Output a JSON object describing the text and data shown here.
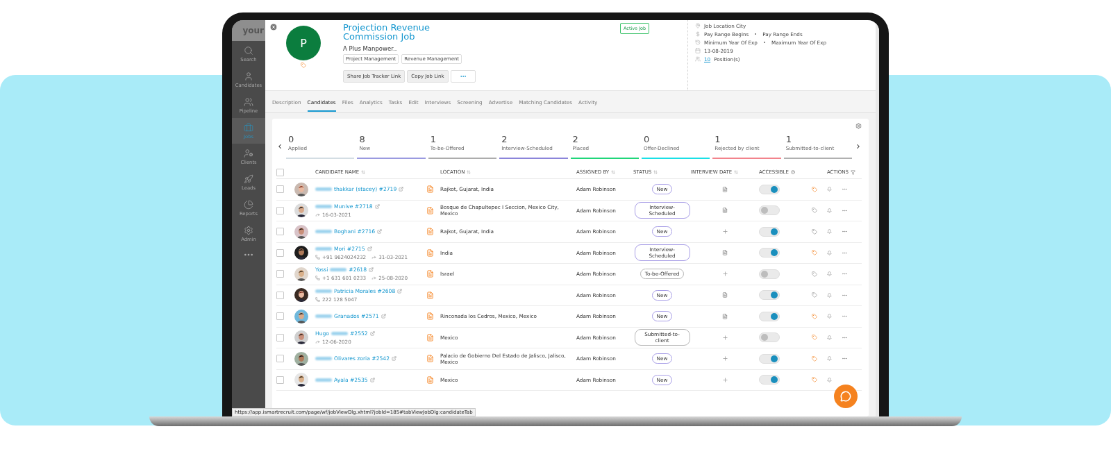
{
  "sidebar": {
    "logo": "your",
    "items": [
      {
        "label": "Search",
        "selected": false
      },
      {
        "label": "Candidates",
        "selected": false
      },
      {
        "label": "Pipeline",
        "selected": false
      },
      {
        "label": "Jobs",
        "selected": true
      },
      {
        "label": "Clients",
        "selected": false
      },
      {
        "label": "Leads",
        "selected": false
      },
      {
        "label": "Reports",
        "selected": false
      },
      {
        "label": "Admin",
        "selected": false
      }
    ]
  },
  "job": {
    "initial": "P",
    "title": "Projection Revenue Commission Job",
    "company": "A Plus Manpower..",
    "skills": [
      "Project Management",
      "Revenue Management"
    ],
    "buttons": [
      "Share Job Tracker Link",
      "Copy Job Link"
    ],
    "status": "Active Job",
    "details": {
      "location": "Job Location City",
      "pay_from": "Pay Range Begins",
      "pay_to": "Pay Range Ends",
      "exp_from": "Minimum Year Of Exp",
      "exp_to": "Maximum Year Of Exp",
      "date": "13-08-2019",
      "positions": "10",
      "positions_label": "Position(s)"
    }
  },
  "tabs": [
    {
      "label": "Description",
      "selected": false
    },
    {
      "label": "Candidates",
      "selected": true
    },
    {
      "label": "Files",
      "selected": false
    },
    {
      "label": "Analytics",
      "selected": false
    },
    {
      "label": "Tasks",
      "selected": false
    },
    {
      "label": "Edit",
      "selected": false
    },
    {
      "label": "Interviews",
      "selected": false
    },
    {
      "label": "Screening",
      "selected": false
    },
    {
      "label": "Advertise",
      "selected": false
    },
    {
      "label": "Matching Candidates",
      "selected": false
    },
    {
      "label": "Activity",
      "selected": false
    }
  ],
  "stats": [
    {
      "count": "0",
      "label": "Applied",
      "color": "#d3dde3"
    },
    {
      "count": "8",
      "label": "New",
      "color": "#9a9ae0"
    },
    {
      "count": "1",
      "label": "To-be-Offered",
      "color": "#acacac"
    },
    {
      "count": "2",
      "label": "Interview-Scheduled",
      "color": "#8b85da"
    },
    {
      "count": "2",
      "label": "Placed",
      "color": "#1fd67a"
    },
    {
      "count": "0",
      "label": "Offer-Declined",
      "color": "#1ae0e6"
    },
    {
      "count": "1",
      "label": "Rejected by client",
      "color": "#f2838c"
    },
    {
      "count": "1",
      "label": "Submitted-to-client",
      "color": "#b0b0b0"
    }
  ],
  "table": {
    "columns": [
      "CANDIDATE NAME",
      "LOCATION",
      "ASSIGNED BY",
      "STATUS",
      "INTERVIEW DATE",
      "ACCESSIBLE",
      "ACTIONS"
    ],
    "all_checked": false,
    "rows": [
      {
        "name_after": "thakkar (stacey) #2719",
        "location": "Rajkot, Gujarat, India",
        "assigned": "Adam Robinson",
        "status": {
          "label": "New",
          "color": "#a79de6"
        },
        "interview": {
          "kind": "file"
        },
        "accessible": true,
        "tagged": true,
        "checked": false,
        "menu": true
      },
      {
        "name_after": "Munive #2718",
        "date": "16-03-2021",
        "location": "Bosque de Chapultepec I Seccion, Mexico City, Mexico",
        "assigned": "Adam Robinson",
        "status": {
          "label": "Interview-Scheduled",
          "color": "#a79de6"
        },
        "interview": {
          "kind": "file"
        },
        "accessible": false,
        "tagged": false,
        "checked": false,
        "menu": true
      },
      {
        "name_after": "Boghani #2716",
        "location": "Rajkot, Gujarat, India",
        "assigned": "Adam Robinson",
        "status": {
          "label": "New",
          "color": "#a79de6"
        },
        "interview": {
          "kind": "add"
        },
        "accessible": true,
        "tagged": false,
        "checked": false,
        "menu": true
      },
      {
        "name_after": "Mori #2715",
        "phone": "+91 9624024232",
        "date": "31-03-2021",
        "location": "India",
        "assigned": "Adam Robinson",
        "status": {
          "label": "Interview-Scheduled",
          "color": "#a79de6"
        },
        "interview": {
          "kind": "file"
        },
        "accessible": true,
        "tagged": true,
        "checked": false,
        "menu": true
      },
      {
        "name_before": "Yossi",
        "name_after": "#2618",
        "phone": "+1 631 601 0233",
        "date": "25-08-2020",
        "location": "Israel",
        "assigned": "Adam Robinson",
        "status": {
          "label": "To-be-Offered",
          "color": "#b5b5b5"
        },
        "interview": {
          "kind": "add"
        },
        "accessible": false,
        "tagged": false,
        "checked": false,
        "menu": true
      },
      {
        "name_after": "Patricia Morales #2608",
        "phone": "222 128 5047",
        "assigned": "Adam Robinson",
        "status": {
          "label": "New",
          "color": "#a79de6"
        },
        "interview": {
          "kind": "file"
        },
        "accessible": true,
        "tagged": false,
        "checked": false,
        "menu": true
      },
      {
        "name_after": "Granados #2571",
        "location": "Rinconada los Cedros, Mexico, Mexico",
        "assigned": "Adam Robinson",
        "status": {
          "label": "New",
          "color": "#a79de6"
        },
        "interview": {
          "kind": "file"
        },
        "accessible": true,
        "tagged": true,
        "checked": false,
        "menu": true
      },
      {
        "name_before": "Hugo",
        "name_after": "#2552",
        "date": "12-06-2020",
        "location": "Mexico",
        "assigned": "Adam Robinson",
        "status": {
          "label": "Submitted-to-client",
          "color": "#b5b5b5"
        },
        "interview": {
          "kind": "add"
        },
        "accessible": false,
        "tagged": true,
        "checked": false,
        "menu": true
      },
      {
        "name_after": "Olivares zoria #2542",
        "location": "Palacio de Gobierno Del Estado de Jalisco, Jalisco, Mexico",
        "assigned": "Adam Robinson",
        "status": {
          "label": "New",
          "color": "#a79de6"
        },
        "interview": {
          "kind": "add"
        },
        "accessible": true,
        "tagged": true,
        "checked": false,
        "menu": true
      },
      {
        "name_after": "Ayala #2535",
        "location": "Mexico",
        "assigned": "Adam Robinson",
        "status": {
          "label": "New",
          "color": "#a79de6"
        },
        "interview": {
          "kind": "add"
        },
        "accessible": true,
        "tagged": true,
        "checked": false,
        "menu": false
      }
    ]
  },
  "status_bar": "https://app.ismartrecruit.com/page/wf/jobViewDlg.xhtml?jobId=185#tabViewJobDlg:candidateTab"
}
